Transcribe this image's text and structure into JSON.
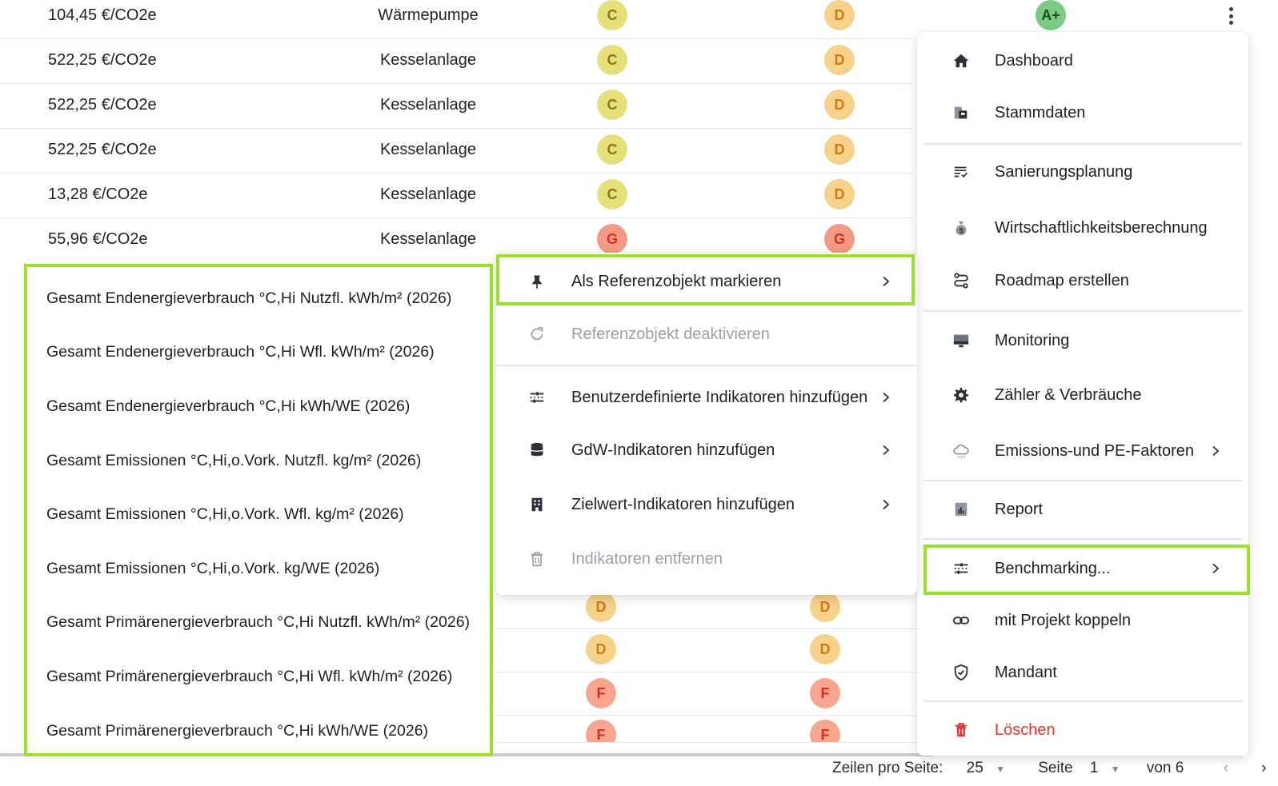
{
  "table": {
    "rows": [
      {
        "cost": "104,45 €/CO2e",
        "heating": "Wärmepumpe",
        "class1": "C",
        "class2": "D",
        "class3": "A+"
      },
      {
        "cost": "522,25 €/CO2e",
        "heating": "Kesselanlage",
        "class1": "C",
        "class2": "D"
      },
      {
        "cost": "522,25 €/CO2e",
        "heating": "Kesselanlage",
        "class1": "C",
        "class2": "D"
      },
      {
        "cost": "522,25 €/CO2e",
        "heating": "Kesselanlage",
        "class1": "C",
        "class2": "D"
      },
      {
        "cost": "13,28 €/CO2e",
        "heating": "Kesselanlage",
        "class1": "C",
        "class2": "D"
      },
      {
        "cost": "55,96 €/CO2e",
        "heating": "Kesselanlage",
        "class1": "G",
        "class2": "G"
      }
    ],
    "lower_badges": [
      {
        "class1": "D",
        "class2": "D"
      },
      {
        "class1": "D",
        "class2": "D"
      },
      {
        "class1": "F",
        "class2": "F"
      },
      {
        "class1": "F",
        "class2": "F"
      }
    ]
  },
  "badge_colors": {
    "A+": {
      "bg": "#7ccb82",
      "fg": "#1f4d22"
    },
    "C": {
      "bg": "#e6e07a",
      "fg": "#8a7a10"
    },
    "D": {
      "bg": "#f6d28a",
      "fg": "#d07a14"
    },
    "F": {
      "bg": "#f7a58e",
      "fg": "#d2321e"
    },
    "G": {
      "bg": "#f39a86",
      "fg": "#d2321e"
    }
  },
  "pagination": {
    "rows_per_page_label": "Zeilen pro Seite:",
    "rows_per_page_value": "25",
    "page_label": "Seite",
    "page_value": "1",
    "of_label": "von 6"
  },
  "main_menu": {
    "items": [
      {
        "label": "Dashboard",
        "icon": "home-icon"
      },
      {
        "label": "Stammdaten",
        "icon": "id-card-icon"
      },
      {
        "label": "Sanierungsplanung",
        "icon": "checklist-icon"
      },
      {
        "label": "Wirtschaftlichkeitsberechnung",
        "icon": "money-bag-icon"
      },
      {
        "label": "Roadmap erstellen",
        "icon": "route-icon"
      },
      {
        "label": "Monitoring",
        "icon": "monitor-icon"
      },
      {
        "label": "Zähler & Verbräuche",
        "icon": "gear-icon"
      },
      {
        "label": "Emissions-und PE-Faktoren",
        "icon": "cloud-icon"
      },
      {
        "label": "Report",
        "icon": "report-icon"
      },
      {
        "label": "Benchmarking...",
        "icon": "sliders-icon"
      },
      {
        "label": "mit Projekt koppeln",
        "icon": "link-icon"
      },
      {
        "label": "Mandant",
        "icon": "shield-icon"
      },
      {
        "label": "Löschen",
        "icon": "trash-icon"
      }
    ]
  },
  "benchmark_menu": {
    "items": [
      {
        "label": "Als Referenzobjekt markieren",
        "icon": "pin-icon"
      },
      {
        "label": "Referenzobjekt deaktivieren",
        "icon": "refresh-icon"
      },
      {
        "label": "Benutzerdefinierte Indikatoren hinzufügen",
        "icon": "sliders-icon"
      },
      {
        "label": "GdW-Indikatoren hinzufügen",
        "icon": "database-icon"
      },
      {
        "label": "Zielwert-Indikatoren hinzufügen",
        "icon": "building-icon"
      },
      {
        "label": "Indikatoren entfernen",
        "icon": "trash-icon"
      }
    ]
  },
  "indicator_list": {
    "items": [
      "Gesamt Endenergieverbrauch °C,Hi Nutzfl. kWh/m² (2026)",
      "Gesamt Endenergieverbrauch °C,Hi Wfl. kWh/m² (2026)",
      "Gesamt Endenergieverbrauch °C,Hi kWh/WE (2026)",
      "Gesamt Emissionen °C,Hi,o.Vork. Nutzfl. kg/m² (2026)",
      "Gesamt Emissionen °C,Hi,o.Vork. Wfl. kg/m² (2026)",
      "Gesamt Emissionen °C,Hi,o.Vork. kg/WE (2026)",
      "Gesamt Primärenergieverbrauch °C,Hi Nutzfl. kWh/m² (2026)",
      "Gesamt Primärenergieverbrauch °C,Hi Wfl. kWh/m² (2026)",
      "Gesamt Primärenergieverbrauch °C,Hi kWh/WE (2026)"
    ]
  },
  "colors": {
    "highlight": "#9be12c",
    "danger": "#e3342f",
    "disabled": "#9aa0a8"
  }
}
